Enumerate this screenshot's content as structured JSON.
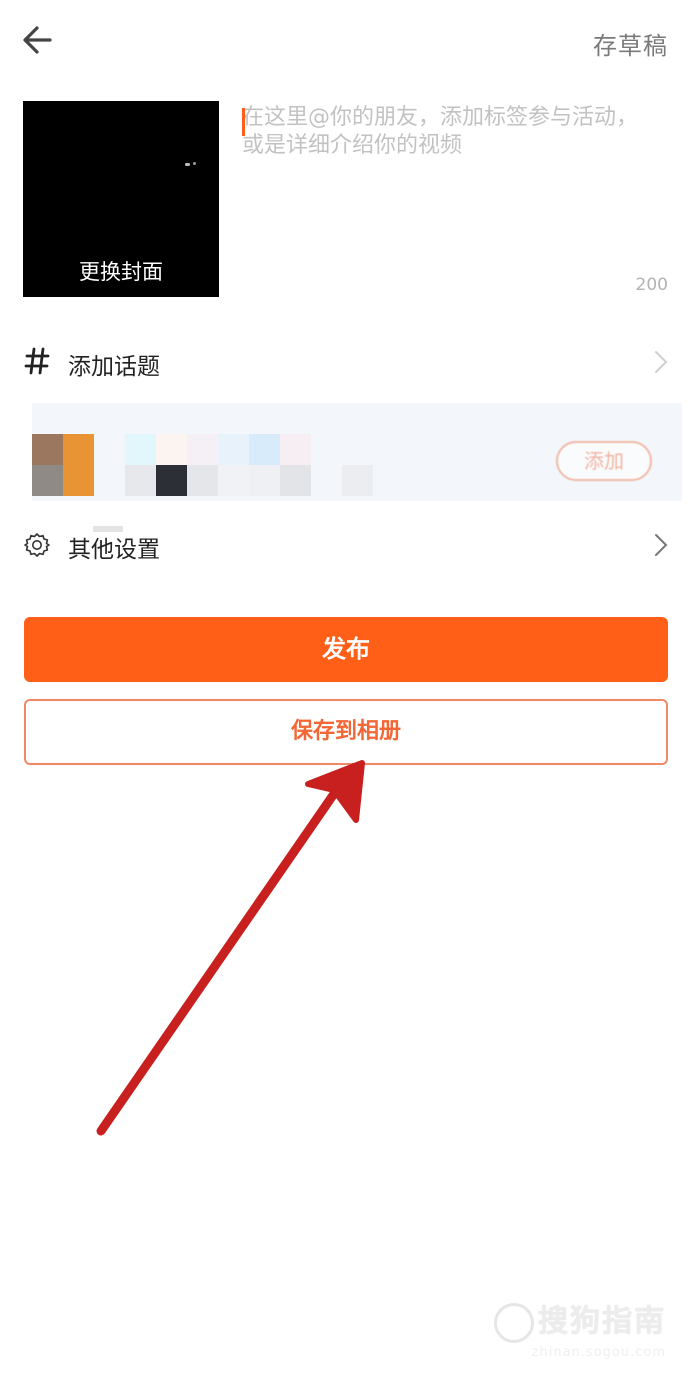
{
  "header": {
    "draft_label": "存草稿"
  },
  "cover": {
    "change_label": "更换封面"
  },
  "description": {
    "placeholder": "在这里@你的朋友，添加标签参与活动，或是详细介绍你的视频",
    "char_count": "200"
  },
  "topic": {
    "label": "添加话题"
  },
  "promo": {
    "add_label": "添加"
  },
  "settings": {
    "label": "其他设置"
  },
  "actions": {
    "publish_label": "发布",
    "save_album_label": "保存到相册"
  },
  "watermark": {
    "main": "搜狗指南",
    "sub": "zhinan.sogou.com"
  },
  "colors": {
    "accent": "#ff5f17",
    "annotation_arrow": "#c8201e"
  },
  "icons": {
    "back": "back-arrow-icon",
    "topic": "hash-icon",
    "settings": "gear-icon",
    "chevron": "chevron-right-icon"
  }
}
